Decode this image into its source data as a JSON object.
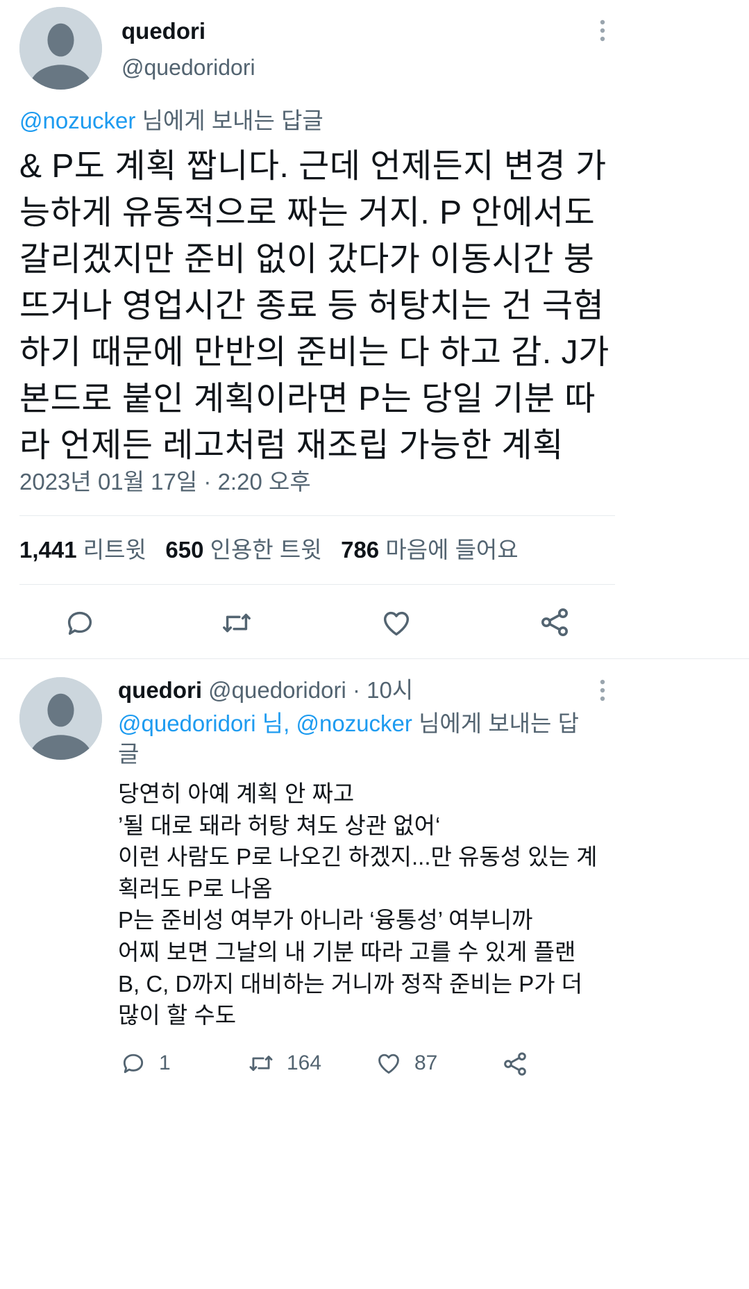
{
  "main_tweet": {
    "display_name": "quedori",
    "handle": "@quedoridori",
    "reply_to": {
      "mention": "@nozucker",
      "suffix": " 님에게 보내는 답글"
    },
    "text_lines": [
      "& P도 계획 짭니다. 근데 언제든지 변경 가",
      "능하게 유동적으로 짜는 거지. P 안에서도",
      "갈리겠지만 준비 없이 갔다가 이동시간 붕",
      "뜨거나 영업시간 종료 등 허탕치는 건 극혐",
      "하기 때문에 만반의 준비는 다 하고 감. J가",
      "본드로 붙인 계획이라면 P는 당일 기분 따",
      "라 언제든 레고처럼 재조립 가능한 계획"
    ],
    "timestamp": "2023년 01월 17일 · 2:20 오후",
    "stats": {
      "retweets_count": "1,441",
      "retweets_label": "리트윗",
      "quotes_count": "650",
      "quotes_label": "인용한 트윗",
      "likes_count": "786",
      "likes_label": "마음에 들어요"
    },
    "actions": [
      "reply-icon",
      "retweet-icon",
      "like-icon",
      "share-icon"
    ]
  },
  "reply_tweet": {
    "display_name": "quedori",
    "handle": "@quedoridori",
    "time": "· 10시",
    "reply_to": {
      "mention1": "@quedoridori",
      "sep": " 님, ",
      "mention2": "@nozucker",
      "suffix_line1": " 님에게 보내는 답",
      "suffix_line2": "글"
    },
    "text_lines": [
      "당연히 아예 계획 안 짜고",
      "’될 대로 돼라 허탕 쳐도 상관 없어‘",
      "이런 사람도 P로 나오긴 하겠지...만 유동성 있는 계",
      "획러도 P로 나옴",
      "P는 준비성 여부가 아니라 ‘융통성’ 여부니까",
      "어찌 보면 그날의 내 기분 따라 고를 수 있게 플랜",
      "B, C, D까지 대비하는 거니까 정작 준비는 P가 더",
      "많이 할 수도"
    ],
    "reply_count": "1",
    "retweet_count": "164",
    "like_count": "87"
  },
  "colors": {
    "text": "#0f1419",
    "secondary": "#536471",
    "link": "#1d9bf0",
    "divider": "#e7ebee",
    "avatar_bg": "#ccd6dd",
    "avatar_fg": "#687783"
  }
}
